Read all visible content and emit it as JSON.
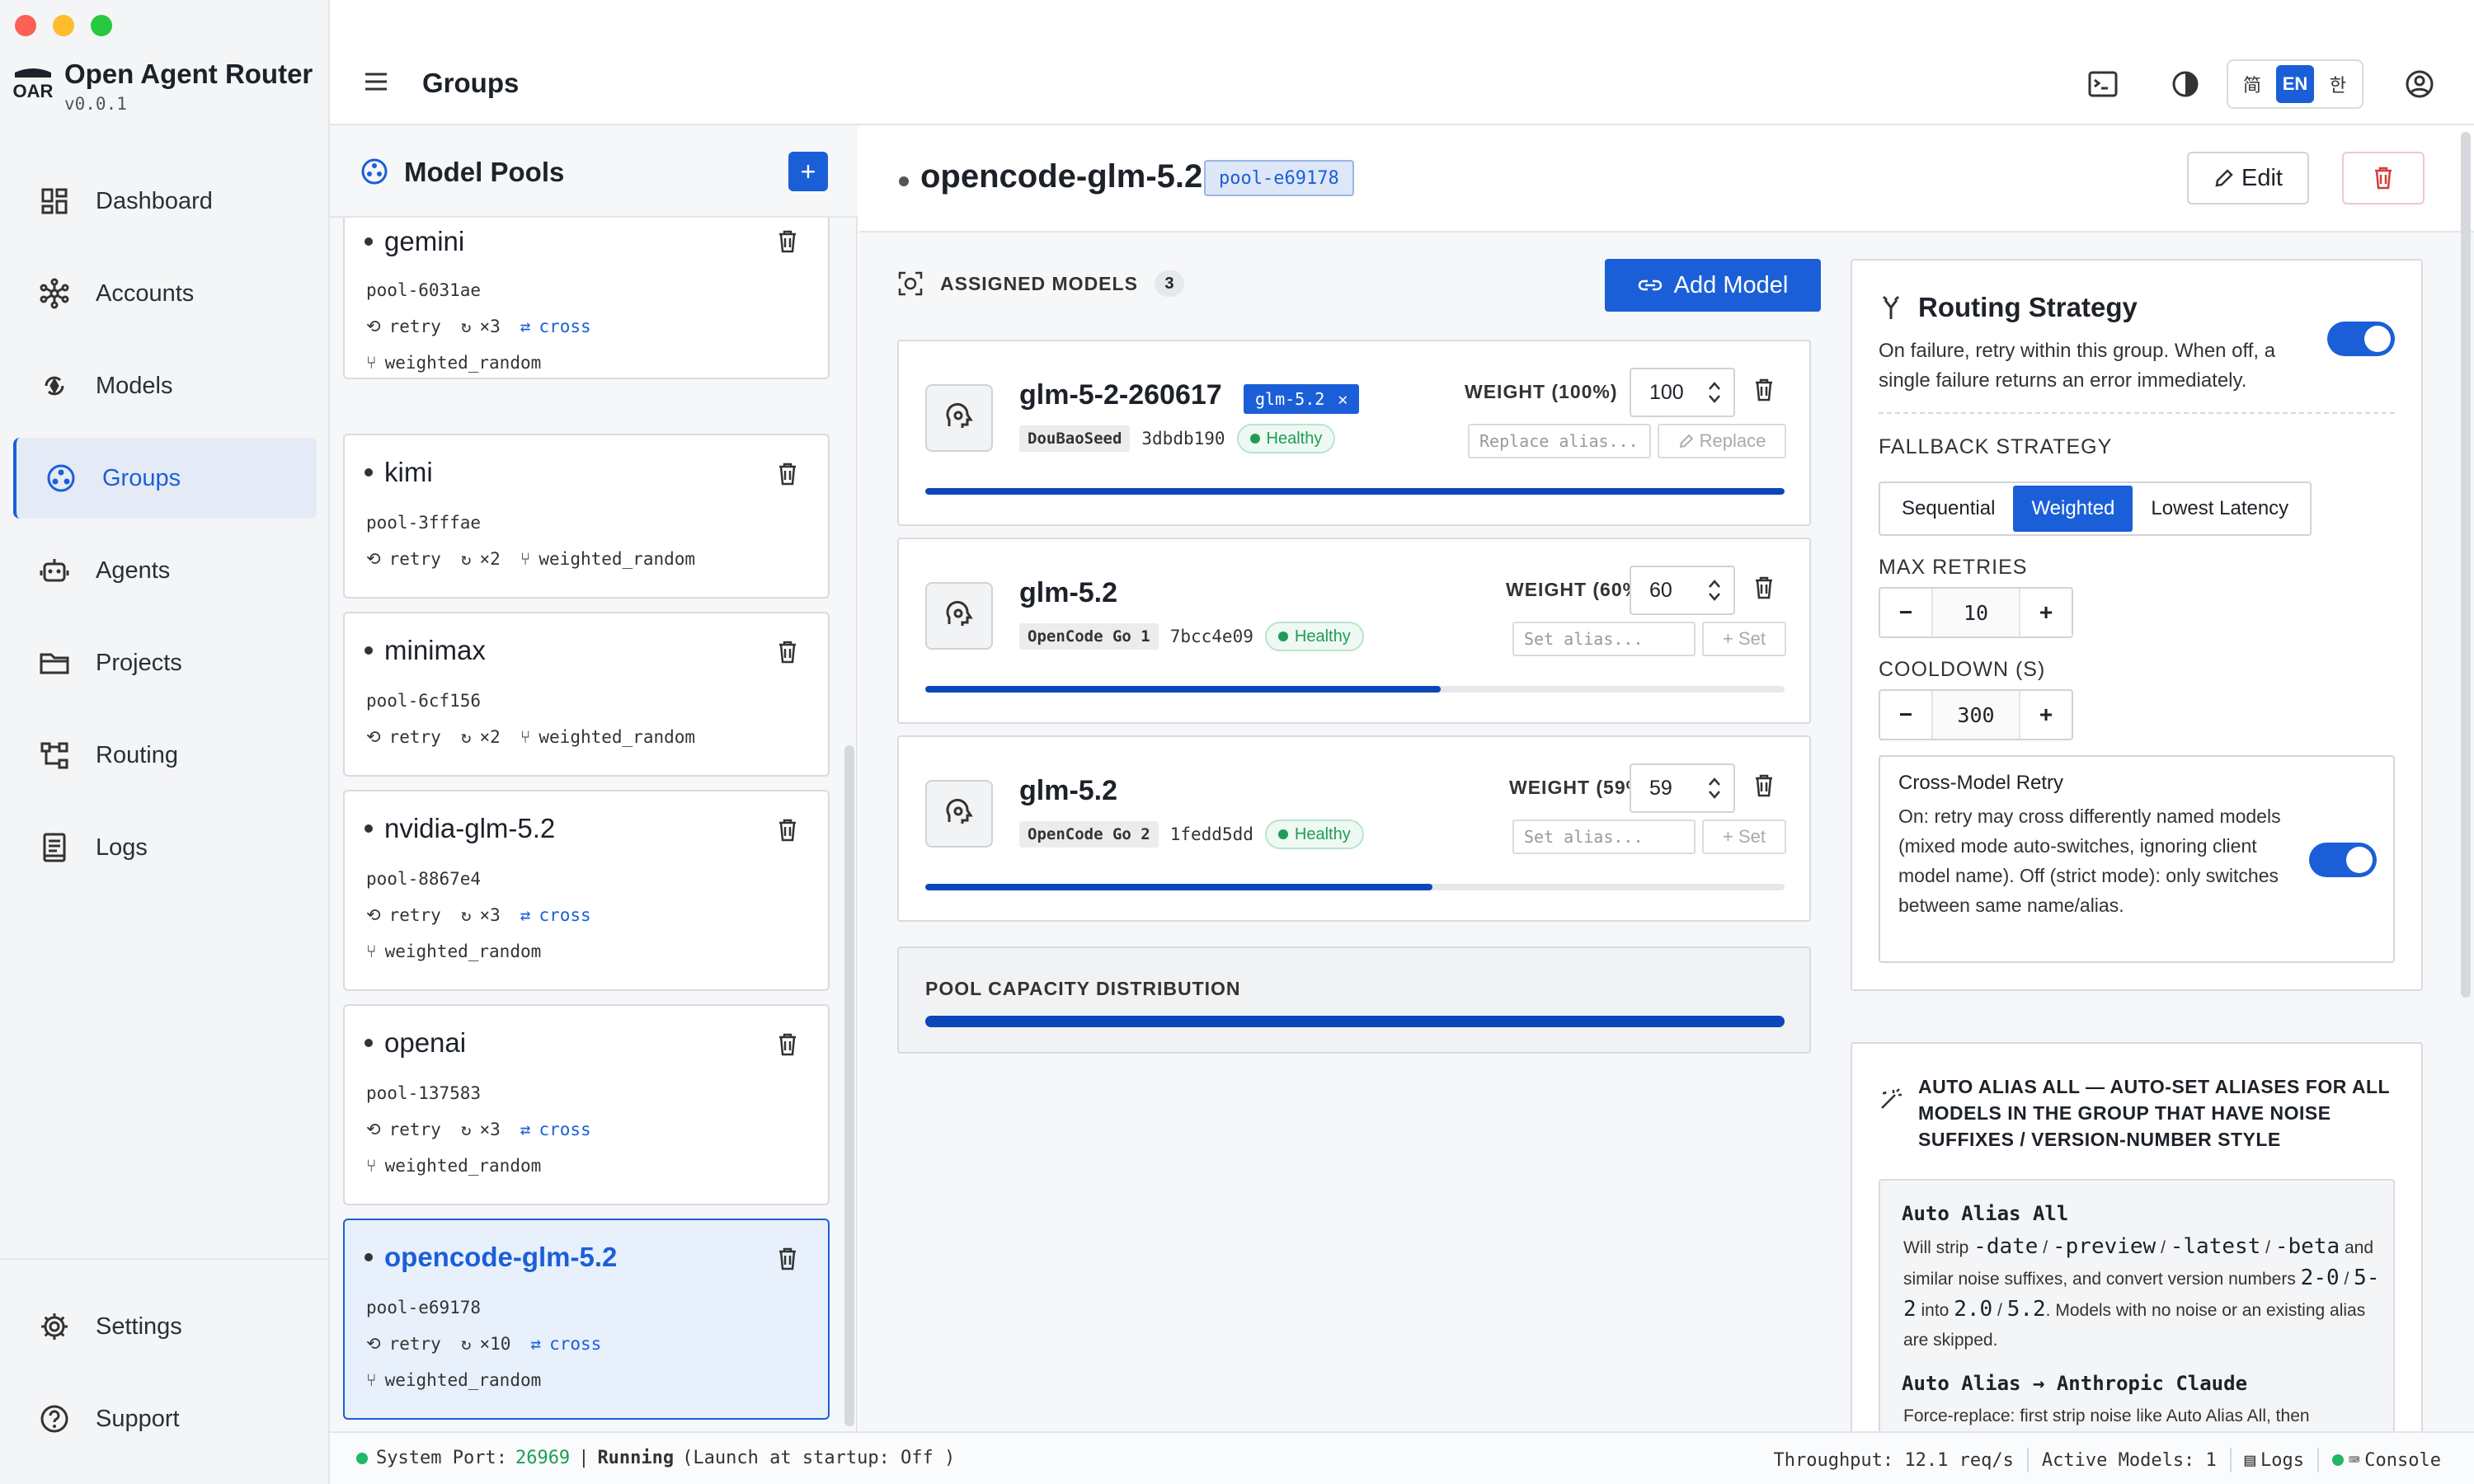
{
  "app": {
    "name": "Open Agent Router",
    "version": "v0.0.1",
    "logo_text": "OAR"
  },
  "header": {
    "title": "Groups",
    "languages": [
      "简",
      "EN",
      "한"
    ],
    "active_language": "EN"
  },
  "sidebar": {
    "items": [
      {
        "label": "Dashboard",
        "icon": "dashboard-icon"
      },
      {
        "label": "Accounts",
        "icon": "accounts-icon"
      },
      {
        "label": "Models",
        "icon": "models-icon"
      },
      {
        "label": "Groups",
        "icon": "groups-icon",
        "active": true
      },
      {
        "label": "Agents",
        "icon": "agents-icon"
      },
      {
        "label": "Projects",
        "icon": "folder-icon"
      },
      {
        "label": "Routing",
        "icon": "routing-icon"
      },
      {
        "label": "Logs",
        "icon": "logs-icon"
      }
    ],
    "bottom": [
      {
        "label": "Settings",
        "icon": "gear-icon"
      },
      {
        "label": "Support",
        "icon": "help-icon"
      }
    ]
  },
  "pools": {
    "title": "Model Pools",
    "add_label": "+",
    "items": [
      {
        "name": "gemini",
        "id": "pool-6031ae",
        "retry": "retry",
        "count": "×3",
        "cross": "cross",
        "strategy": "weighted_random"
      },
      {
        "name": "kimi",
        "id": "pool-3fffae",
        "retry": "retry",
        "count": "×2",
        "cross": "",
        "strategy": "weighted_random"
      },
      {
        "name": "minimax",
        "id": "pool-6cf156",
        "retry": "retry",
        "count": "×2",
        "cross": "",
        "strategy": "weighted_random"
      },
      {
        "name": "nvidia-glm-5.2",
        "id": "pool-8867e4",
        "retry": "retry",
        "count": "×3",
        "cross": "cross",
        "strategy": "weighted_random"
      },
      {
        "name": "openai",
        "id": "pool-137583",
        "retry": "retry",
        "count": "×3",
        "cross": "cross",
        "strategy": "weighted_random"
      },
      {
        "name": "opencode-glm-5.2",
        "id": "pool-e69178",
        "retry": "retry",
        "count": "×10",
        "cross": "cross",
        "strategy": "weighted_random",
        "active": true
      }
    ]
  },
  "detail": {
    "name": "opencode-glm-5.2",
    "pool_id": "pool-e69178",
    "edit_label": "Edit",
    "assigned_label": "ASSIGNED MODELS",
    "assigned_count": "3",
    "add_model_label": "Add Model",
    "models": [
      {
        "name": "glm-5-2-260617",
        "alias": "glm-5.2",
        "account": "DouBaoSeed",
        "hash": "3dbdb190",
        "status": "Healthy",
        "weight_label": "WEIGHT (100%)",
        "weight": "100",
        "share": 1.0,
        "alias_placeholder": "Replace alias...",
        "action": "Replace"
      },
      {
        "name": "glm-5.2",
        "alias": "",
        "account": "OpenCode Go 1",
        "hash": "7bcc4e09",
        "status": "Healthy",
        "weight_label": "WEIGHT (60%)",
        "weight": "60",
        "share": 0.6,
        "alias_placeholder": "Set alias...",
        "action": "+ Set"
      },
      {
        "name": "glm-5.2",
        "alias": "",
        "account": "OpenCode Go 2",
        "hash": "1fedd5dd",
        "status": "Healthy",
        "weight_label": "WEIGHT (59%)",
        "weight": "59",
        "share": 0.59,
        "alias_placeholder": "Set alias...",
        "action": "+ Set"
      }
    ],
    "capacity_label": "POOL CAPACITY DISTRIBUTION"
  },
  "routing": {
    "title": "Routing Strategy",
    "description": "On failure, retry within this group. When off, a single failure returns an error immediately.",
    "enabled": true,
    "fallback_label": "FALLBACK STRATEGY",
    "fallback_options": [
      "Sequential",
      "Weighted",
      "Lowest Latency"
    ],
    "fallback_selected": "Weighted",
    "max_retries_label": "MAX RETRIES",
    "max_retries": "10",
    "cooldown_label": "COOLDOWN (S)",
    "cooldown": "300",
    "cross_title": "Cross-Model Retry",
    "cross_desc": "On: retry may cross differently named models (mixed mode auto-switches, ignoring client model name). Off (strict mode): only switches between same name/alias.",
    "cross_enabled": true
  },
  "auto_alias": {
    "title": "AUTO ALIAS ALL — AUTO-SET ALIASES FOR ALL MODELS IN THE GROUP THAT HAVE NOISE SUFFIXES / VERSION-NUMBER STYLE",
    "h1": "Auto Alias All",
    "p1_a": "Will strip",
    "code1": "-date",
    "sep": "/",
    "code2": "-preview",
    "code3": "-latest",
    "code4": "-beta",
    "p1_b": "and similar noise suffixes, and convert version numbers",
    "code5": "2-0",
    "code6": "5-2",
    "p1_into": "into",
    "code7": "2.0",
    "code8": "5.2",
    "p1_c": ". Models with no noise or an existing alias are skipped.",
    "h2": "Auto Alias → Anthropic Claude",
    "p2": "Force-replace: first strip noise like Auto Alias All, then"
  },
  "status": {
    "port_label": "System Port:",
    "port": "26969",
    "pipe": "|",
    "running": "Running",
    "startup": "(Launch at startup: Off )",
    "throughput": "Throughput: 12.1 req/s",
    "active_models": "Active Models: 1",
    "logs": "Logs",
    "console": "Console"
  },
  "colors": {
    "accent": "#1b5fd8",
    "healthy": "#1f9d55",
    "bar": "#0a47b8",
    "danger": "#d63b3b"
  }
}
